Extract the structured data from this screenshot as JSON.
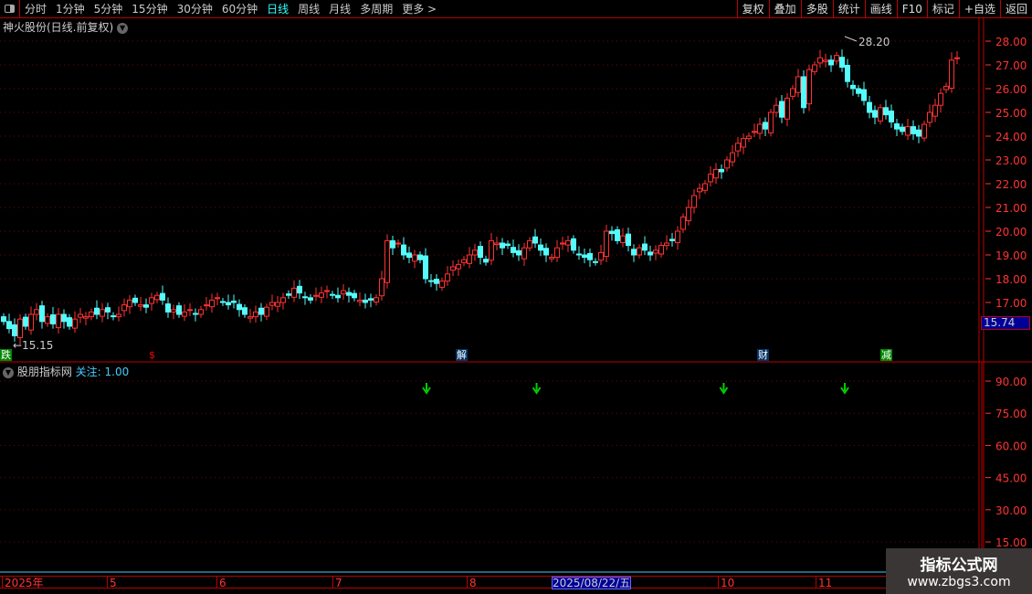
{
  "toolbar": {
    "periods": [
      "分时",
      "1分钟",
      "5分钟",
      "15分钟",
      "30分钟",
      "60分钟",
      "日线",
      "周线",
      "月线",
      "多周期",
      "更多 >"
    ],
    "active": "日线",
    "buttons": [
      "复权",
      "叠加",
      "多股",
      "统计",
      "画线",
      "F10",
      "标记",
      "+自选",
      "返回"
    ]
  },
  "main": {
    "title": "神火股份(日线.前复权)",
    "high_label": "28.20",
    "low_label": "←15.15",
    "current_price": "15.74",
    "price_axis": [
      "28.00",
      "27.00",
      "26.00",
      "25.00",
      "24.00",
      "23.00",
      "22.00",
      "21.00",
      "20.00",
      "19.00",
      "18.00",
      "17.00"
    ],
    "markers": [
      {
        "text": "跌",
        "color": "#fff",
        "bg": "#080"
      },
      {
        "text": "$",
        "color": "#f00",
        "bg": ""
      },
      {
        "text": "解",
        "color": "#fff",
        "bg": "#036"
      },
      {
        "text": "财",
        "color": "#fff",
        "bg": "#036"
      },
      {
        "text": "减",
        "color": "#fff",
        "bg": "#080"
      }
    ],
    "colors": {
      "up": "#ff3232",
      "down": "#54fcfc"
    }
  },
  "chart_data": {
    "type": "candlestick",
    "ylim": [
      15,
      28.2
    ],
    "close": [
      16.2,
      15.9,
      15.6,
      16.3,
      16.0,
      16.5,
      16.7,
      16.2,
      16.4,
      16.1,
      16.5,
      16.2,
      16.0,
      16.3,
      16.5,
      16.4,
      16.6,
      16.5,
      16.7,
      16.6,
      16.4,
      16.5,
      16.9,
      17.1,
      17.0,
      16.9,
      16.8,
      17.2,
      17.3,
      17.1,
      16.6,
      16.7,
      16.5,
      16.6,
      16.7,
      16.5,
      16.7,
      16.9,
      17.1,
      17.2,
      17.0,
      16.9,
      17.0,
      16.7,
      16.5,
      16.4,
      16.6,
      16.5,
      16.8,
      17.0,
      17.0,
      17.2,
      17.3,
      17.6,
      17.4,
      17.2,
      17.1,
      17.3,
      17.4,
      17.5,
      17.3,
      17.2,
      17.5,
      17.3,
      17.2,
      17.1,
      17.0,
      17.1,
      17.2,
      18.0,
      19.6,
      19.3,
      19.5,
      19.0,
      18.9,
      19.0,
      18.8,
      18.0,
      17.9,
      17.8,
      17.9,
      18.2,
      18.5,
      18.6,
      18.8,
      19.0,
      19.2,
      18.9,
      18.7,
      19.6,
      19.5,
      19.3,
      19.4,
      19.1,
      19.0,
      19.3,
      19.6,
      19.5,
      19.2,
      19.0,
      18.9,
      19.3,
      19.5,
      19.6,
      19.2,
      19.0,
      18.9,
      18.8,
      18.7,
      19.1,
      20.0,
      19.9,
      19.6,
      19.8,
      19.4,
      19.0,
      19.3,
      19.2,
      19.0,
      19.2,
      19.4,
      19.5,
      19.6,
      20.0,
      20.6,
      21.0,
      21.5,
      21.8,
      22.0,
      22.4,
      22.6,
      22.5,
      23.0,
      23.3,
      23.7,
      23.9,
      24.0,
      24.2,
      24.5,
      24.3,
      25.0,
      25.3,
      24.8,
      25.6,
      26.0,
      26.5,
      25.2,
      26.8,
      27.0,
      27.3,
      27.2,
      27.0,
      27.4,
      26.9,
      26.3,
      26.0,
      25.8,
      25.5,
      25.0,
      24.8,
      25.2,
      24.9,
      24.6,
      24.3,
      24.2,
      24.4,
      24.1,
      24.0,
      24.5,
      25.0,
      25.3,
      25.8,
      26.1,
      27.2,
      27.3
    ],
    "signal_candles": [
      77,
      97,
      131,
      153
    ]
  },
  "indicator": {
    "name": "股朋指标网",
    "attention": "关注: 1.00",
    "axis": [
      "90.00",
      "75.00",
      "60.00",
      "45.00",
      "30.00",
      "15.00"
    ]
  },
  "date_axis": {
    "labels": [
      "2025年",
      "5",
      "6",
      "7",
      "8",
      "10",
      "11"
    ],
    "selected": "2025/08/22/五"
  },
  "watermark": {
    "line1": "指标公式网",
    "line2": "www.zbgs3.com"
  }
}
